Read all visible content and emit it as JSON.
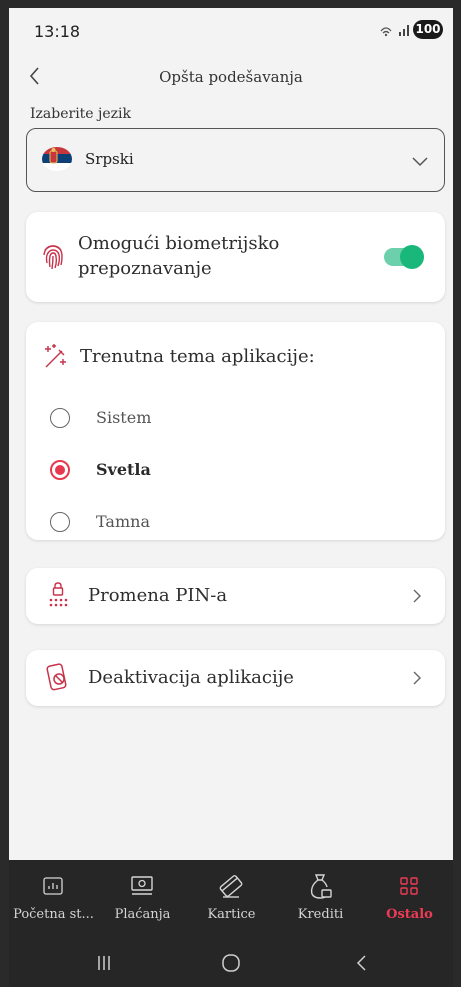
{
  "status_bar": {
    "time": "13:18",
    "signal": "⋮.∣∣∣",
    "battery": "100"
  },
  "header": {
    "title": "Opšta podešavanja",
    "back_icon": "chevron-left-icon"
  },
  "language": {
    "label": "Izaberite jezik",
    "selected": "Srpski",
    "flag_icon": "serbia-flag-icon"
  },
  "biometrics": {
    "label": "Omogući biometrijsko prepoznavanje",
    "enabled": true
  },
  "theme": {
    "heading": "Trenutna tema aplikacije:",
    "options": [
      {
        "label": "Sistem",
        "selected": false
      },
      {
        "label": "Svetla",
        "selected": true
      },
      {
        "label": "Tamna",
        "selected": false
      }
    ]
  },
  "menu": {
    "pin_label": "Promena PIN-a",
    "deactivate_label": "Deaktivacija aplikacije"
  },
  "bottom_nav": {
    "tabs": [
      {
        "label": "Početna st...",
        "icon": "dashboard-icon",
        "active": false
      },
      {
        "label": "Plaćanja",
        "icon": "payments-icon",
        "active": false
      },
      {
        "label": "Kartice",
        "icon": "card-icon",
        "active": false
      },
      {
        "label": "Krediti",
        "icon": "money-bag-icon",
        "active": false
      },
      {
        "label": "Ostalo",
        "icon": "grid-icon",
        "active": true
      }
    ]
  },
  "colors": {
    "accent": "#e63950",
    "toggle_on": "#19b87a",
    "nav_bg": "#262626",
    "screen_bg": "#f3f3f3"
  }
}
